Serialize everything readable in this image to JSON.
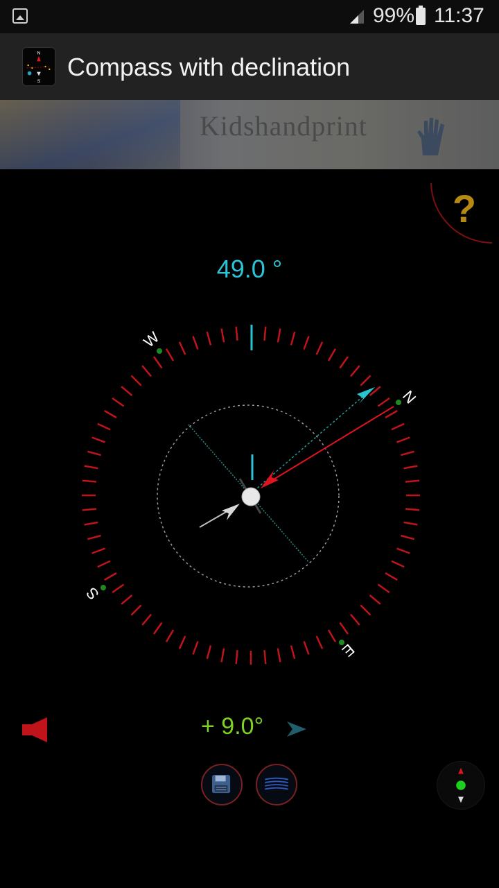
{
  "status_bar": {
    "battery_percent": "99%",
    "time": "11:37"
  },
  "app_bar": {
    "title": "Compass with declination",
    "icon_letters": [
      "N",
      "S"
    ]
  },
  "banner": {
    "brand_text": "Kidshandprint"
  },
  "compass": {
    "heading_text": "49.0 °",
    "heading_deg": 49.0,
    "cardinals": [
      "N",
      "E",
      "S",
      "W"
    ],
    "colors": {
      "ticks": "#c0141a",
      "north_needle": "#e0141e",
      "true_north": "#27c3cf",
      "south_needle": "#d8d8d8",
      "heading_text": "#2bc4d6"
    }
  },
  "declination": {
    "text": "+ 9.0°",
    "value_deg": 9.0,
    "color": "#7ed321"
  },
  "controls": {
    "help_icon": "question-mark-icon",
    "speaker_icon": "speaker-icon",
    "save_icon": "floppy-disk-icon",
    "lines_icon": "magnetic-lines-icon",
    "calibrate_icon": "compass-calibrate-icon"
  }
}
